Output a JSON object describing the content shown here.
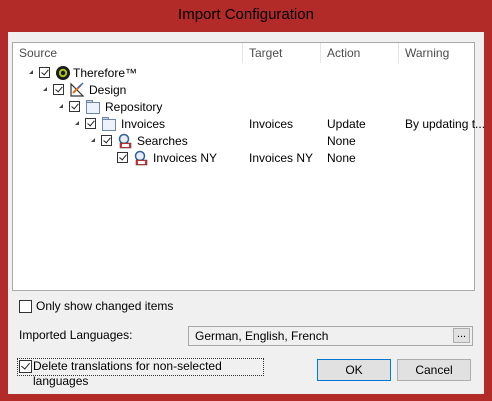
{
  "window": {
    "title": "Import Configuration",
    "frame_color": "#b32b28"
  },
  "tree": {
    "columns": [
      "Source",
      "Target",
      "Action",
      "Warning"
    ],
    "rows": [
      {
        "source": "Therefore™",
        "target": "",
        "action": "",
        "warning": "",
        "icon": "therefore-logo-icon"
      },
      {
        "source": "Design",
        "target": "",
        "action": "",
        "warning": "",
        "icon": "design-tools-icon"
      },
      {
        "source": "Repository",
        "target": "",
        "action": "",
        "warning": "",
        "icon": "repository-icon"
      },
      {
        "source": "Invoices",
        "target": "Invoices",
        "action": "Update",
        "warning": "By updating t...",
        "icon": "category-icon"
      },
      {
        "source": "Searches",
        "target": "",
        "action": "None",
        "warning": "",
        "icon": "search-config-icon"
      },
      {
        "source": "Invoices NY",
        "target": "Invoices NY",
        "action": "None",
        "warning": "",
        "icon": "saved-search-icon"
      }
    ]
  },
  "only_changed": {
    "label": "Only show changed items",
    "checked": false
  },
  "languages": {
    "label": "Imported Languages:",
    "value": "German, English, French",
    "browse": "..."
  },
  "delete_translations": {
    "label": "Delete translations for non-selected languages",
    "checked": true
  },
  "buttons": {
    "ok": "OK",
    "cancel": "Cancel"
  }
}
